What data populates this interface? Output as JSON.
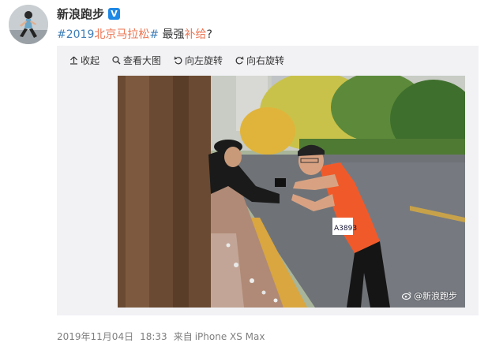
{
  "author": {
    "name": "新浪跑步",
    "verified_badge": "V"
  },
  "post": {
    "hashtag_prefix": "#2019",
    "hashtag_highlight": "北京马拉松",
    "hashtag_suffix": "#",
    "text_part1": " 最强",
    "text_highlight": "补给",
    "text_part2": "?"
  },
  "toolbar": {
    "collapse": "收起",
    "view_large": "查看大图",
    "rotate_left": "向左旋转",
    "rotate_right": "向右旋转"
  },
  "image": {
    "watermark": "@新浪跑步",
    "bib_number": "A3893"
  },
  "footer": {
    "date": "2019年11月04日",
    "time": "18:33",
    "source_prefix": "来自",
    "source_device": "iPhone XS Max"
  },
  "colors": {
    "link": "#3d7eb8",
    "highlight": "#eb7350",
    "badge": "#1e88e5"
  }
}
